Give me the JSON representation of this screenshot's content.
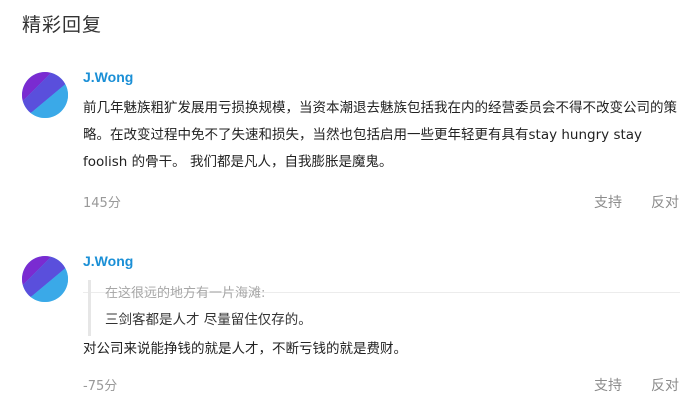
{
  "section": {
    "title": "精彩回复"
  },
  "colors": {
    "username": "#1a8fd6",
    "muted": "#999999",
    "action": "#8c8c8c",
    "divider": "#ececec"
  },
  "comments": [
    {
      "avatar_icon": "user-avatar-icon",
      "username": "J.Wong",
      "body": "前几年魅族粗犷发展用亏损换规模，当资本潮退去魅族包括我在内的经营委员会不得不改变公司的策略。在改变过程中免不了失速和损失，当然也包括启用一些更年轻更有具有stay hungry stay foolish 的骨干。 我们都是凡人，自我膨胀是魔鬼。",
      "score": "145分",
      "support_label": "支持",
      "oppose_label": "反对"
    },
    {
      "avatar_icon": "user-avatar-icon",
      "username": "J.Wong",
      "quote": {
        "source": "在这很远的地方有一片海滩:",
        "text": "三剑客都是人才 尽量留住仅存的。"
      },
      "body": "对公司来说能挣钱的就是人才，不断亏钱的就是费财。",
      "score": "-75分",
      "support_label": "支持",
      "oppose_label": "反对"
    }
  ]
}
